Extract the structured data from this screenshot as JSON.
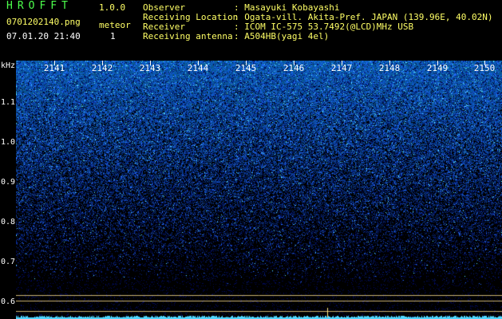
{
  "app": {
    "name": "HROFFT",
    "version": "1.0.0"
  },
  "file": {
    "name": "0701202140.png",
    "datetime": "07.01.20 21:40"
  },
  "counter": {
    "label": "meteor",
    "value": "1"
  },
  "station": [
    {
      "key": "Observer",
      "value": ": Masayuki Kobayashi"
    },
    {
      "key": "Receiving Location",
      "value": ": Ogata-vill. Akita-Pref. JAPAN (139.96E, 40.02N)"
    },
    {
      "key": "Receiver",
      "value": ": ICOM IC-575 53.7492(@LCD)MHz USB"
    },
    {
      "key": "Receiving antenna",
      "value": ": A504HB(yagi 4el)"
    }
  ],
  "axis": {
    "unit": "kHz",
    "freq_ticks": [
      "1.1",
      "1.0",
      "0.9",
      "0.8",
      "0.7",
      "0.6"
    ],
    "time_ticks": [
      "2141",
      "2142",
      "2143",
      "2144",
      "2145",
      "2146",
      "2147",
      "2148",
      "2149",
      "2150"
    ]
  },
  "colors": {
    "background": "#000000",
    "header_green": "#4cff4c",
    "header_yellow": "#ffff66",
    "noise_blue": "#1e3cff",
    "noise_cyan": "#4fd6ff",
    "marker_line": "#c8b070"
  }
}
